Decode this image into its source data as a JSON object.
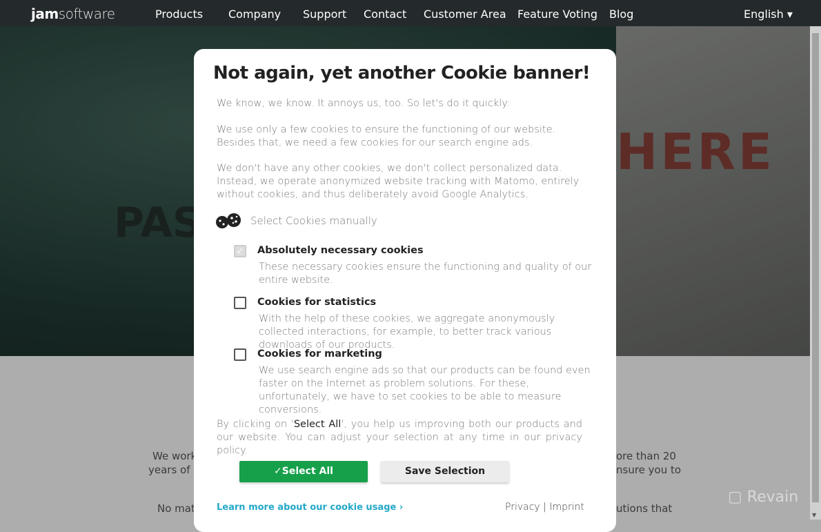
{
  "nav": {
    "logo_bold": "jam",
    "logo_light": "software",
    "items": [
      "Products",
      "Company",
      "Support",
      "Contact",
      "Customer Area",
      "Feature Voting",
      "Blog"
    ],
    "language": "English ▾"
  },
  "hero": {
    "sign_right": "HERE",
    "sign_left": "PAS"
  },
  "background_text": {
    "line1_left": "We work",
    "line1_right": "ore than 20",
    "line2_left": "years of e",
    "line2_right": "nsure you to",
    "line3_left": "No matt",
    "line3_right": "utions that"
  },
  "watermark": "Revain",
  "modal": {
    "title": "Not again, yet another Cookie banner!",
    "intro": "We know, we know. It annoys us, too. So let's do it quickly:",
    "p1": "We use only a few cookies to ensure the functioning of our website. Besides that, we need a few cookies for our search engine ads.",
    "p2": "We don't have any other cookies, we don't collect personalized data. Instead, we operate anonymized website tracking with Matomo, entirely without cookies, and thus deliberately avoid Google Analytics.",
    "manual_label": "Select Cookies manually",
    "options": [
      {
        "label": "Absolutely necessary cookies",
        "desc": "These necessary cookies ensure the functioning and quality of our entire website.",
        "checked": true,
        "disabled": true
      },
      {
        "label": "Cookies for statistics",
        "desc": "With the help of these cookies, we aggregate anonymously collected interactions, for example, to better track various downloads of our products.",
        "checked": false
      },
      {
        "label": "Cookies for marketing",
        "desc": "We use search engine ads so that our products can be found even faster on the Internet as problem solutions. For these, unfortunately, we have to set cookies to be able to measure conversions.",
        "checked": false
      }
    ],
    "consent_pre": "By clicking on '",
    "consent_bold": "Select All",
    "consent_post": "', you help us improving both our products and our website. You can adjust your selection at any time in our privacy policy.",
    "select_all": "✓Select All",
    "save_selection": "Save Selection",
    "learn_more": "Learn more about our cookie usage  ›",
    "privacy": "Privacy",
    "sep": "|",
    "imprint": "Imprint"
  },
  "colors": {
    "nav_bg": "#24292b",
    "select_all": "#16a04a",
    "link": "#23a8c9"
  }
}
